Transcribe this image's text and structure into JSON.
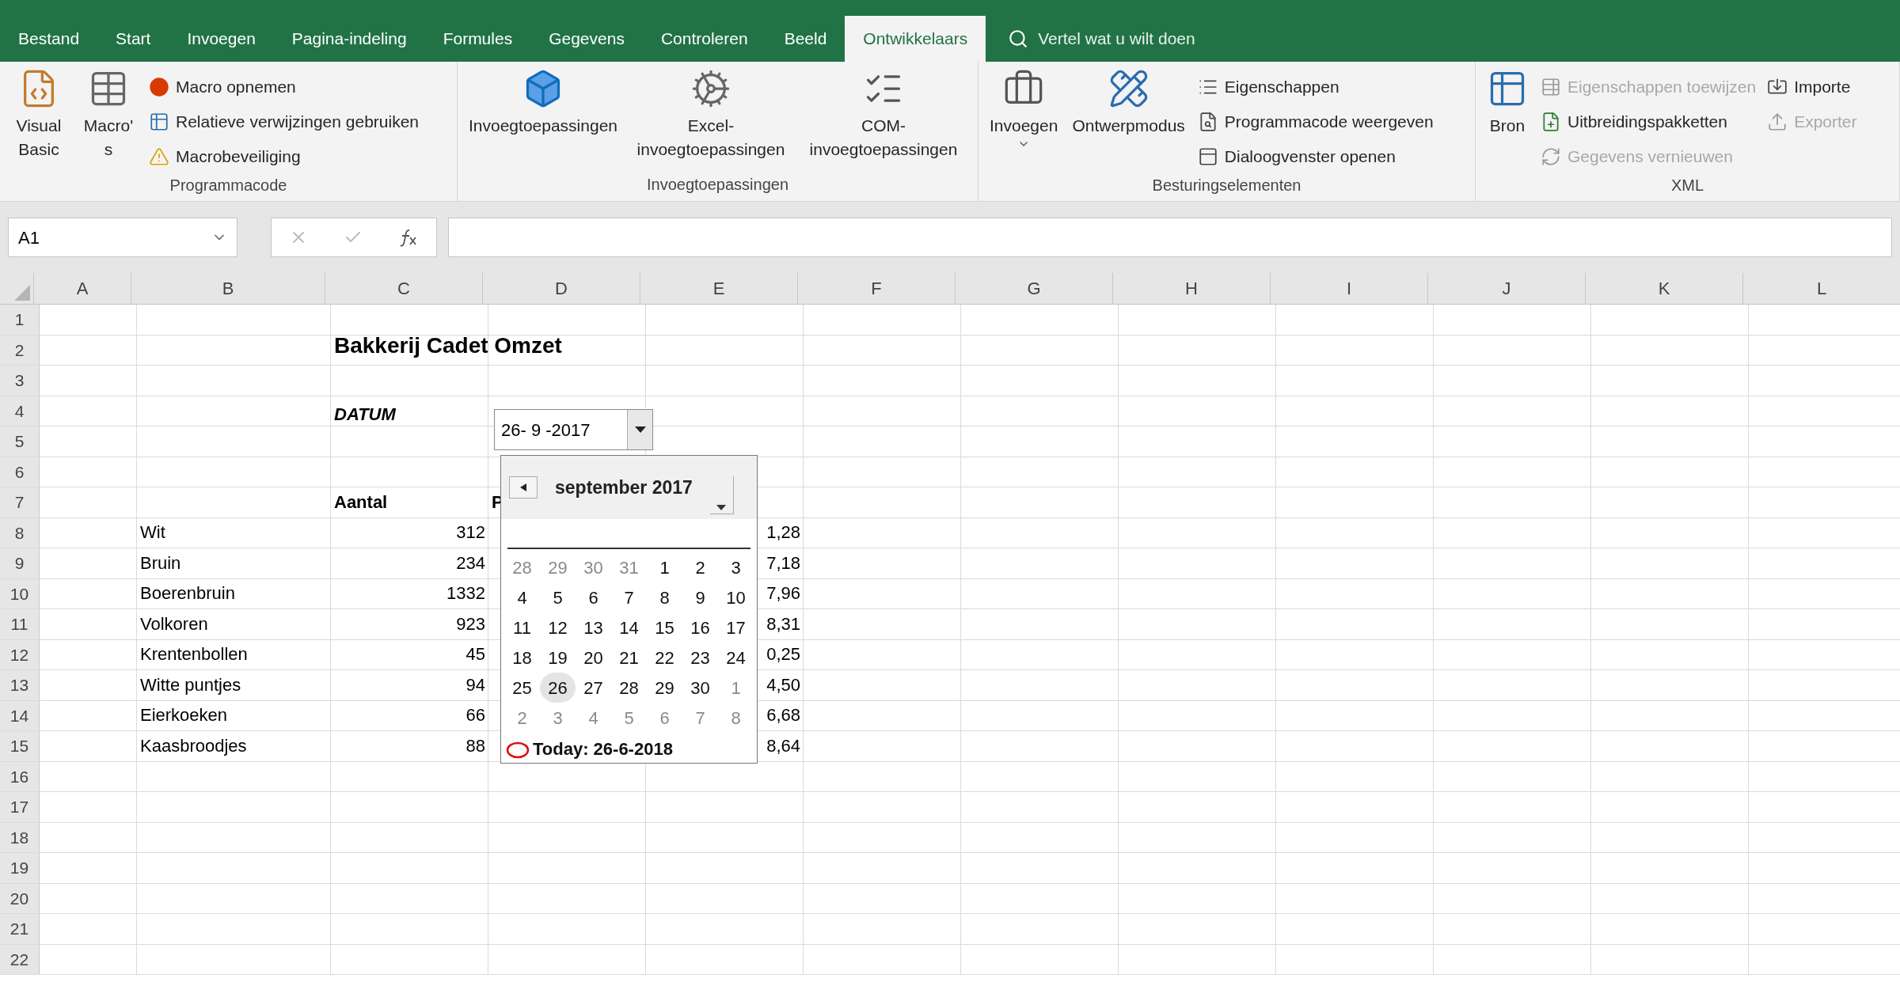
{
  "tabs": [
    {
      "label": "Bestand",
      "selected": false
    },
    {
      "label": "Start",
      "selected": false
    },
    {
      "label": "Invoegen",
      "selected": false
    },
    {
      "label": "Pagina-indeling",
      "selected": false
    },
    {
      "label": "Formules",
      "selected": false
    },
    {
      "label": "Gegevens",
      "selected": false
    },
    {
      "label": "Controleren",
      "selected": false
    },
    {
      "label": "Beeld",
      "selected": false
    },
    {
      "label": "Ontwikkelaars",
      "selected": true
    }
  ],
  "tell_me": {
    "label": "Vertel wat u wilt doen"
  },
  "ribbon_groups": [
    {
      "title": "Programmacode",
      "columns": [
        {
          "kind": "large",
          "label": "Visual Basic",
          "disabled": false
        },
        {
          "kind": "large",
          "label": "Macro's",
          "disabled": false
        },
        {
          "kind": "stack",
          "items": [
            {
              "label": "Macro opnemen",
              "disabled": false
            },
            {
              "label": "Relatieve verwijzingen gebruiken",
              "disabled": false
            },
            {
              "label": "Macrobeveiliging",
              "disabled": false
            }
          ]
        }
      ]
    },
    {
      "title": "Invoegtoepassingen",
      "columns": [
        {
          "kind": "large",
          "label": "Invoegtoepassingen",
          "disabled": false
        },
        {
          "kind": "large",
          "label": "Excel-invoegtoepassingen",
          "disabled": false
        },
        {
          "kind": "large",
          "label": "COM-invoegtoepassingen",
          "disabled": false
        }
      ]
    },
    {
      "title": "Besturingselementen",
      "columns": [
        {
          "kind": "large",
          "label": "Invoegen",
          "disabled": false,
          "dropdown": true
        },
        {
          "kind": "large",
          "label": "Ontwerpmodus",
          "disabled": false
        },
        {
          "kind": "stack",
          "items": [
            {
              "label": "Eigenschappen",
              "disabled": false
            },
            {
              "label": "Programmacode weergeven",
              "disabled": false
            },
            {
              "label": "Dialoogvenster openen",
              "disabled": false
            }
          ]
        }
      ]
    },
    {
      "title": "XML",
      "columns": [
        {
          "kind": "large",
          "label": "Bron",
          "disabled": false
        },
        {
          "kind": "stack",
          "items": [
            {
              "label": "Eigenschappen toewijzen",
              "disabled": true
            },
            {
              "label": "Uitbreidingspakketten",
              "disabled": false
            },
            {
              "label": "Gegevens vernieuwen",
              "disabled": true
            }
          ]
        },
        {
          "kind": "stack",
          "items": [
            {
              "label": "Importe",
              "disabled": false
            },
            {
              "label": "Exporter",
              "disabled": true
            }
          ]
        }
      ]
    }
  ],
  "name_box": {
    "value": "A1"
  },
  "columns": [
    "A",
    "B",
    "C",
    "D",
    "E",
    "F",
    "G",
    "H",
    "I",
    "J",
    "K",
    "L"
  ],
  "rows": [
    {
      "number": "1"
    },
    {
      "number": "2",
      "title": "Bakkerij Cadet Omzet"
    },
    {
      "number": "3"
    },
    {
      "number": "4",
      "label": "DATUM"
    },
    {
      "number": "5"
    },
    {
      "number": "6"
    },
    {
      "number": "7",
      "headers": [
        "Aantal",
        "P"
      ]
    },
    {
      "number": "8",
      "product": "Wit",
      "amount": "312",
      "total": "1,28"
    },
    {
      "number": "9",
      "product": "Bruin",
      "amount": "234",
      "total": "7,18"
    },
    {
      "number": "10",
      "product": "Boerenbruin",
      "amount": "1332",
      "total": "7,96"
    },
    {
      "number": "11",
      "product": "Volkoren",
      "amount": "923",
      "total": "8,31"
    },
    {
      "number": "12",
      "product": "Krentenbollen",
      "amount": "45",
      "total": "0,25"
    },
    {
      "number": "13",
      "product": "Witte puntjes",
      "amount": "94",
      "total": "4,50"
    },
    {
      "number": "14",
      "product": "Eierkoeken",
      "amount": "66",
      "total": "6,68"
    },
    {
      "number": "15",
      "product": "Kaasbroodjes",
      "amount": "88",
      "total": "8,64"
    },
    {
      "number": "16"
    },
    {
      "number": "17"
    },
    {
      "number": "18"
    },
    {
      "number": "19"
    },
    {
      "number": "20"
    },
    {
      "number": "21"
    },
    {
      "number": "22"
    }
  ],
  "date_picker": {
    "value": "26- 9 -2017",
    "calendar": {
      "month": "september 2017",
      "today": "Today: 26-6-2018",
      "days": [
        {
          "label": "28",
          "muted": true,
          "selected": false
        },
        {
          "label": "29",
          "muted": true,
          "selected": false
        },
        {
          "label": "30",
          "muted": true,
          "selected": false
        },
        {
          "label": "31",
          "muted": true,
          "selected": false
        },
        {
          "label": "1",
          "muted": false,
          "selected": false
        },
        {
          "label": "2",
          "muted": false,
          "selected": false
        },
        {
          "label": "3",
          "muted": false,
          "selected": false
        },
        {
          "label": "4",
          "muted": false,
          "selected": false
        },
        {
          "label": "5",
          "muted": false,
          "selected": false
        },
        {
          "label": "6",
          "muted": false,
          "selected": false
        },
        {
          "label": "7",
          "muted": false,
          "selected": false
        },
        {
          "label": "8",
          "muted": false,
          "selected": false
        },
        {
          "label": "9",
          "muted": false,
          "selected": false
        },
        {
          "label": "10",
          "muted": false,
          "selected": false
        },
        {
          "label": "11",
          "muted": false,
          "selected": false
        },
        {
          "label": "12",
          "muted": false,
          "selected": false
        },
        {
          "label": "13",
          "muted": false,
          "selected": false
        },
        {
          "label": "14",
          "muted": false,
          "selected": false
        },
        {
          "label": "15",
          "muted": false,
          "selected": false
        },
        {
          "label": "16",
          "muted": false,
          "selected": false
        },
        {
          "label": "17",
          "muted": false,
          "selected": false
        },
        {
          "label": "18",
          "muted": false,
          "selected": false
        },
        {
          "label": "19",
          "muted": false,
          "selected": false
        },
        {
          "label": "20",
          "muted": false,
          "selected": false
        },
        {
          "label": "21",
          "muted": false,
          "selected": false
        },
        {
          "label": "22",
          "muted": false,
          "selected": false
        },
        {
          "label": "23",
          "muted": false,
          "selected": false
        },
        {
          "label": "24",
          "muted": false,
          "selected": false
        },
        {
          "label": "25",
          "muted": false,
          "selected": false
        },
        {
          "label": "26",
          "muted": false,
          "selected": true
        },
        {
          "label": "27",
          "muted": false,
          "selected": false
        },
        {
          "label": "28",
          "muted": false,
          "selected": false
        },
        {
          "label": "29",
          "muted": false,
          "selected": false
        },
        {
          "label": "30",
          "muted": false,
          "selected": false
        },
        {
          "label": "1",
          "muted": true,
          "selected": false
        },
        {
          "label": "2",
          "muted": true,
          "selected": false
        },
        {
          "label": "3",
          "muted": true,
          "selected": false
        },
        {
          "label": "4",
          "muted": true,
          "selected": false
        },
        {
          "label": "5",
          "muted": true,
          "selected": false
        },
        {
          "label": "6",
          "muted": true,
          "selected": false
        },
        {
          "label": "7",
          "muted": true,
          "selected": false
        },
        {
          "label": "8",
          "muted": true,
          "selected": false
        }
      ]
    }
  }
}
